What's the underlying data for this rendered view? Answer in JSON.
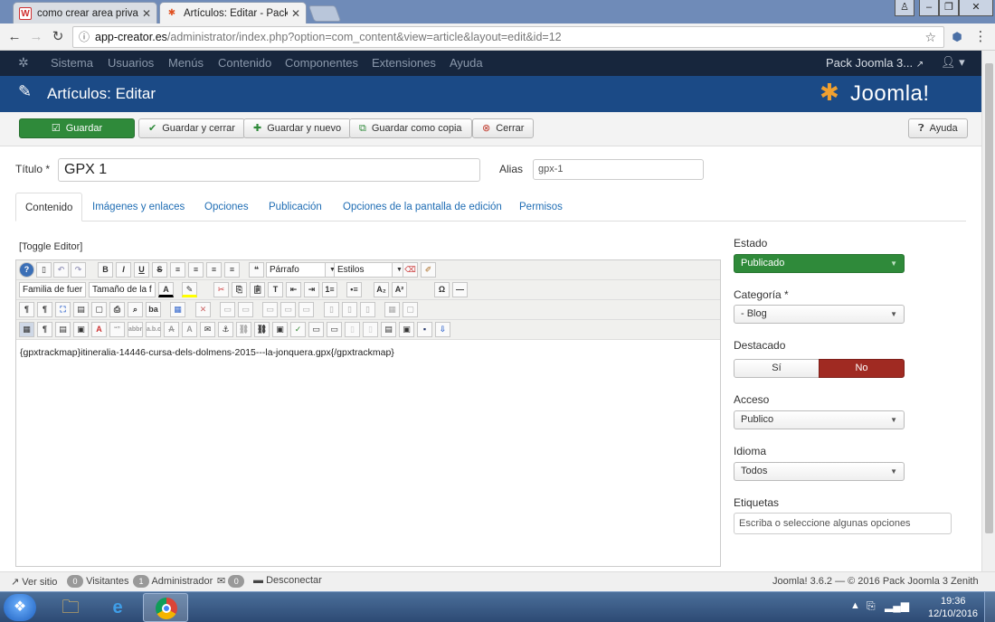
{
  "browser": {
    "tabs": [
      {
        "title": "como crear area privada",
        "favicon": "W"
      },
      {
        "title": "Artículos: Editar - Pack Jo",
        "favicon": "J"
      }
    ],
    "url_host": "app-creator.es",
    "url_path": "/administrator/index.php?option=com_content&view=article&layout=edit&id=12"
  },
  "topnav": {
    "items": [
      "Sistema",
      "Usuarios",
      "Menús",
      "Contenido",
      "Componentes",
      "Extensiones",
      "Ayuda"
    ],
    "site_name": "Pack Joomla 3..."
  },
  "header": {
    "title": "Artículos: Editar",
    "logo_text": "Joomla!"
  },
  "toolbar": {
    "save": "Guardar",
    "save_close": "Guardar y cerrar",
    "save_new": "Guardar y nuevo",
    "save_copy": "Guardar como copia",
    "close": "Cerrar",
    "help": "Ayuda"
  },
  "form": {
    "title_label": "Título *",
    "title_value": "GPX 1",
    "alias_label": "Alias",
    "alias_value": "gpx-1"
  },
  "tabs": [
    "Contenido",
    "Imágenes y enlaces",
    "Opciones",
    "Publicación",
    "Opciones de la pantalla de edición",
    "Permisos"
  ],
  "editor": {
    "toggle": "[Toggle Editor]",
    "format_select": "Párrafo",
    "styles_select": "Estilos",
    "font_family_select": "Familia de fuer",
    "font_size_select": "Tamaño de la f",
    "content": "{gpxtrackmap}itineralia-14446-cursa-dels-dolmens-2015---la-jonquera.gpx{/gpxtrackmap}"
  },
  "sidebar": {
    "estado_label": "Estado",
    "estado_value": "Publicado",
    "categoria_label": "Categoría *",
    "categoria_value": "- Blog",
    "destacado_label": "Destacado",
    "destacado_yes": "Sí",
    "destacado_no": "No",
    "acceso_label": "Acceso",
    "acceso_value": "Publico",
    "idioma_label": "Idioma",
    "idioma_value": "Todos",
    "etiquetas_label": "Etiquetas",
    "etiquetas_placeholder": "Escriba o seleccione algunas opciones"
  },
  "status": {
    "view_site": "Ver sitio",
    "visitors_count": "0",
    "visitors_label": "Visitantes",
    "admin_count": "1",
    "admin_label": "Administrador",
    "messages_count": "0",
    "logout": "Desconectar",
    "version": "Joomla! 3.6.2 — © 2016 Pack Joomla 3 Zenith"
  },
  "taskbar": {
    "time": "19:36",
    "date": "12/10/2016"
  },
  "colors": {
    "nav_bg": "#17263d",
    "title_bg": "#1b4a86",
    "save_green": "#2f8a3a",
    "no_red": "#a02a22",
    "link": "#1f6db4"
  }
}
